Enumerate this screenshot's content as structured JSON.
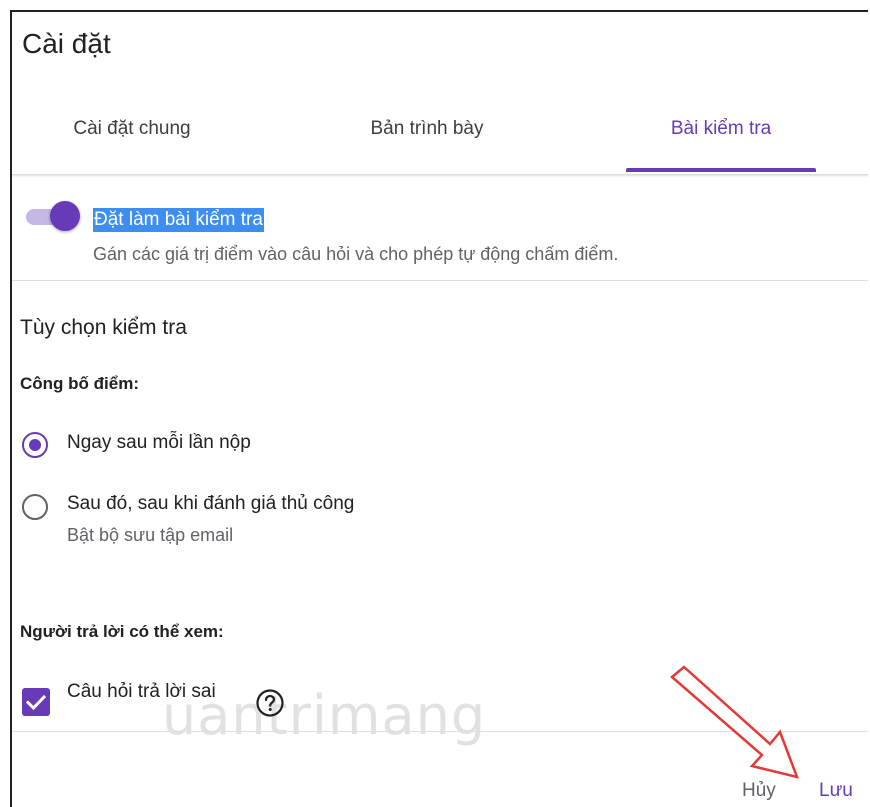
{
  "dialog": {
    "title": "Cài đặt"
  },
  "tabs": [
    {
      "label": "Cài đặt chung",
      "active": false
    },
    {
      "label": "Bản trình bày",
      "active": false
    },
    {
      "label": "Bài kiểm tra",
      "active": true
    }
  ],
  "quiz_toggle": {
    "enabled": true,
    "label": "Đặt làm bài kiểm tra",
    "description": "Gán các giá trị điểm vào câu hỏi và cho phép tự động chấm điểm."
  },
  "quiz_options": {
    "section_title": "Tùy chọn kiểm tra",
    "release_grade": {
      "label": "Công bố điểm:",
      "options": [
        {
          "label": "Ngay sau mỗi lần nộp",
          "selected": true
        },
        {
          "label": "Sau đó, sau khi đánh giá thủ công",
          "sublabel": "Bật bộ sưu tập email",
          "selected": false
        }
      ]
    },
    "respondent_can_see": {
      "label": "Người trả lời có thể xem:",
      "items": [
        {
          "label": "Câu hỏi trả lời sai",
          "checked": true
        }
      ]
    }
  },
  "watermark": "uantrimang",
  "footer": {
    "cancel_label": "Hủy",
    "save_label": "Lưu"
  },
  "colors": {
    "accent": "#673ab7",
    "selection_highlight": "#3d8ef0",
    "annotation_arrow": "#e53935"
  },
  "icons": {
    "help": "help-circle-icon",
    "check": "check-icon",
    "arrow": "red-arrow-annotation"
  }
}
